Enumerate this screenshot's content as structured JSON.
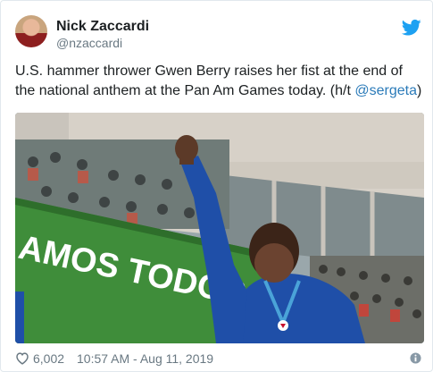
{
  "user": {
    "name": "Nick Zaccardi",
    "handle": "@nzaccardi"
  },
  "tweet": {
    "text_before_mention": "U.S. hammer thrower Gwen Berry raises her fist at the end of the national anthem at the Pan Am Games today. (h/t ",
    "mention": "@sergeta",
    "text_after_mention": ")"
  },
  "media": {
    "banner_text": "AMOS TODOS"
  },
  "footer": {
    "likes": "6,002",
    "timestamp": "10:57 AM - Aug 11, 2019"
  },
  "colors": {
    "link": "#2b7bb9",
    "twitter_blue": "#1da1f2",
    "muted": "#697882"
  },
  "icons": [
    "twitter-bird-icon",
    "heart-icon",
    "info-icon"
  ]
}
